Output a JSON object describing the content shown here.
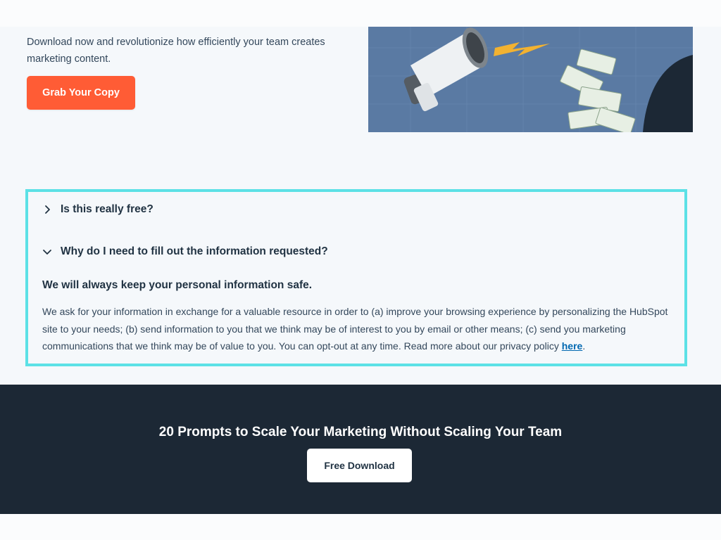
{
  "hero": {
    "description": "Download now and revolutionize how efficiently your team creates marketing content.",
    "cta_label": "Grab Your Copy",
    "image_icon": "megaphone-money-illustration"
  },
  "faq": {
    "items": [
      {
        "question": "Is this really free?",
        "expanded": false,
        "icon": "chevron-right-icon"
      },
      {
        "question": "Why do I need to fill out the information requested?",
        "expanded": true,
        "icon": "chevron-down-icon"
      }
    ],
    "answer": {
      "title": "We will always keep your personal information safe.",
      "body": "We ask for your information in exchange for a valuable resource in order to (a) improve your browsing experience by personalizing the HubSpot site to your needs; (b) send information to you that we think may be of interest to you by email or other means; (c) send you marketing communications that we think may be of value to you. You can opt-out at any time. Read more about our privacy policy ",
      "link_text": "here",
      "trailing": "."
    }
  },
  "promo": {
    "title": "20 Prompts to Scale Your Marketing Without Scaling Your Team",
    "button_label": "Free Download"
  },
  "colors": {
    "accent": "#ff5c35",
    "highlight_border": "#5ce1e6",
    "dark_band": "#1c2835",
    "link": "#0068b1"
  }
}
